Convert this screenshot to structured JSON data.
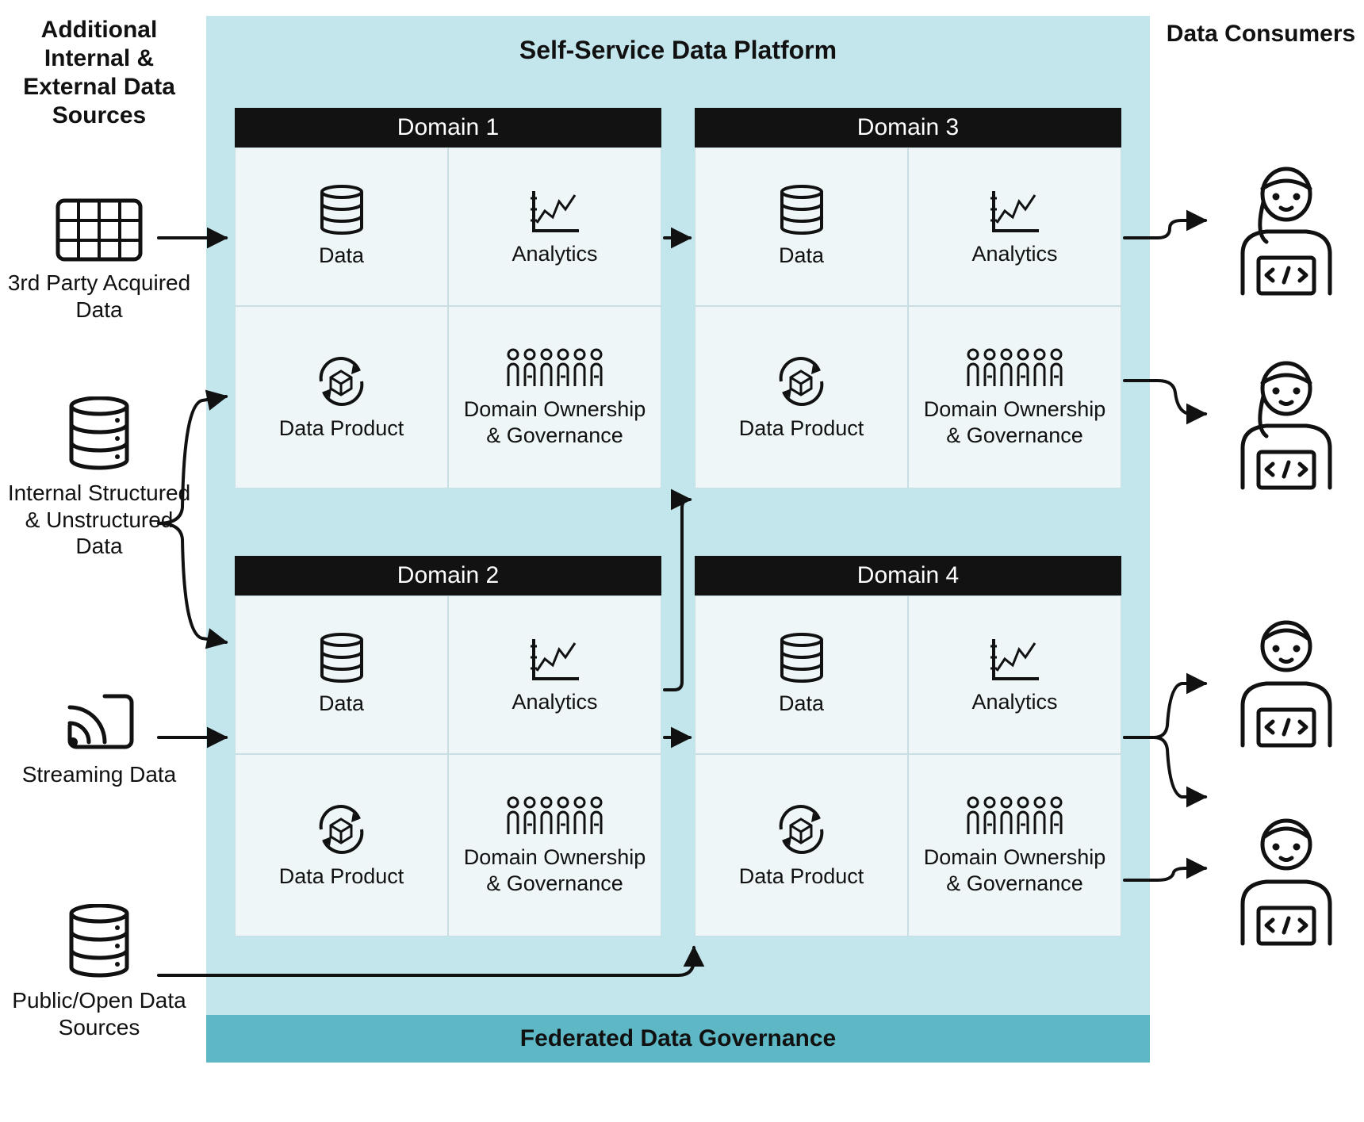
{
  "left": {
    "title": "Additional Internal & External Data Sources",
    "sources": [
      {
        "label": "3rd Party Acquired Data",
        "icon": "table-grid"
      },
      {
        "label": "Internal Structured & Unstructured Data",
        "icon": "database-stack"
      },
      {
        "label": "Streaming Data",
        "icon": "streaming"
      },
      {
        "label": "Public/Open Data Sources",
        "icon": "database-stack"
      }
    ]
  },
  "platform": {
    "title": "Self-Service Data Platform",
    "domains": [
      {
        "header": "Domain 1",
        "cells": [
          "Data",
          "Analytics",
          "Data Product",
          "Domain Ownership & Governance"
        ]
      },
      {
        "header": "Domain 2",
        "cells": [
          "Data",
          "Analytics",
          "Data Product",
          "Domain Ownership & Governance"
        ]
      },
      {
        "header": "Domain 3",
        "cells": [
          "Data",
          "Analytics",
          "Data Product",
          "Domain Ownership & Governance"
        ]
      },
      {
        "header": "Domain 4",
        "cells": [
          "Data",
          "Analytics",
          "Data Product",
          "Domain Ownership & Governance"
        ]
      }
    ],
    "governance_bar": "Federated Data Governance"
  },
  "right": {
    "title": "Data Consumers"
  },
  "cell_icons": [
    "database-stack",
    "line-chart",
    "data-product-cycle",
    "people-group"
  ]
}
